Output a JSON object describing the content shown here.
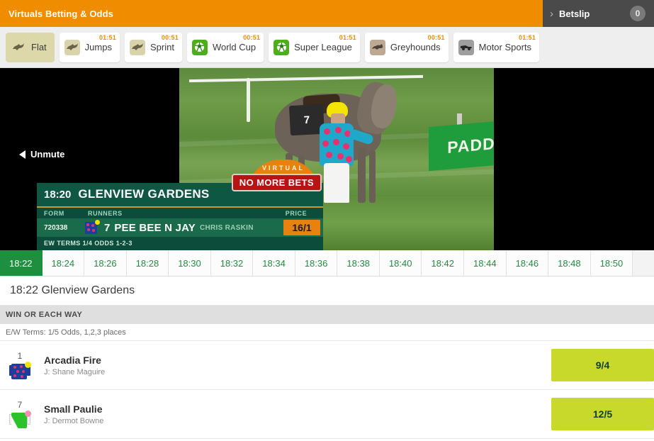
{
  "header": {
    "title": "Virtuals Betting & Odds",
    "betslip_label": "Betslip",
    "betslip_count": "0",
    "chevron": "›",
    "accent_color": "#f08c00",
    "betslip_bg": "#4a4a4a"
  },
  "sports_tabs": [
    {
      "label": "Flat",
      "timer": "",
      "icon": "horse-icon",
      "active": true
    },
    {
      "label": "Jumps",
      "timer": "01:51",
      "icon": "horse-icon",
      "active": false
    },
    {
      "label": "Sprint",
      "timer": "00:51",
      "icon": "horse-icon",
      "active": false
    },
    {
      "label": "World Cup",
      "timer": "00:51",
      "icon": "football-icon",
      "active": false
    },
    {
      "label": "Super League",
      "timer": "01:51",
      "icon": "football-icon",
      "active": false
    },
    {
      "label": "Greyhounds",
      "timer": "00:51",
      "icon": "greyhound-icon",
      "active": false
    },
    {
      "label": "Motor Sports",
      "timer": "01:51",
      "icon": "racecar-icon",
      "active": false
    }
  ],
  "video": {
    "unmute_label": "Unmute",
    "saddle_cloth_number": "7",
    "background_sign": "PADD",
    "overlay": {
      "virtual_label": "VIRTUAL",
      "status_badge": "NO MORE BETS",
      "race_time": "18:20",
      "race_name": "GLENVIEW GARDENS",
      "col_form": "FORM",
      "col_runners": "RUNNERS",
      "col_price": "PRICE",
      "runner_form": "720338",
      "runner_number": "7",
      "runner_name": "PEE BEE N JAY",
      "runner_jockey": "CHRIS RASKIN",
      "runner_price": "16/1",
      "ew_terms": "EW TERMS 1/4 ODDS 1-2-3"
    }
  },
  "time_slots": [
    {
      "time": "18:22",
      "active": true
    },
    {
      "time": "18:24",
      "active": false
    },
    {
      "time": "18:26",
      "active": false
    },
    {
      "time": "18:28",
      "active": false
    },
    {
      "time": "18:30",
      "active": false
    },
    {
      "time": "18:32",
      "active": false
    },
    {
      "time": "18:34",
      "active": false
    },
    {
      "time": "18:36",
      "active": false
    },
    {
      "time": "18:38",
      "active": false
    },
    {
      "time": "18:40",
      "active": false
    },
    {
      "time": "18:42",
      "active": false
    },
    {
      "time": "18:44",
      "active": false
    },
    {
      "time": "18:46",
      "active": false
    },
    {
      "time": "18:48",
      "active": false
    },
    {
      "time": "18:50",
      "active": false
    }
  ],
  "race": {
    "title": "18:22 Glenview Gardens",
    "market_header": "WIN OR EACH WAY",
    "ew_terms": "E/W Terms: 1/5 Odds, 1,2,3 places",
    "runners": [
      {
        "number": "1",
        "name": "Arcadia Fire",
        "jockey": "J: Shane Maguire",
        "odds": "9/4",
        "silk": {
          "body": "#1b3f9c",
          "sleeve": "#1b3f9c",
          "dot": "#e8306e",
          "cap": "#f2e200",
          "pattern": "spots"
        }
      },
      {
        "number": "7",
        "name": "Small Paulie",
        "jockey": "J: Dermot Bowne",
        "odds": "12/5",
        "silk": {
          "body": "#2bc22b",
          "sleeve": "#f2f2f2",
          "dot": "#ffffff",
          "cap": "#f48fb1",
          "pattern": "stripe"
        }
      }
    ],
    "odds_color": "#c8d92b",
    "odds_text_color": "#10402a"
  }
}
